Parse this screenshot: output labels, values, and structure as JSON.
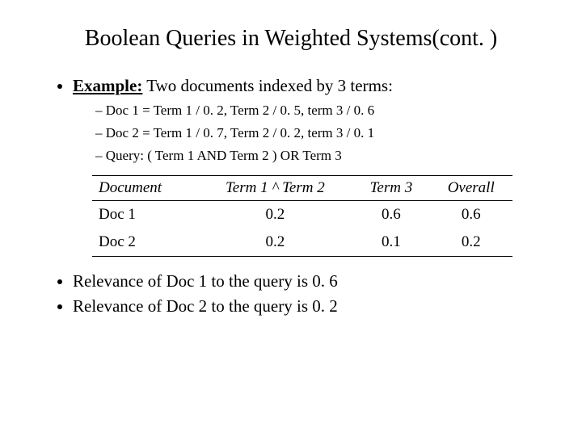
{
  "title": "Boolean Queries in Weighted Systems(cont. )",
  "example_label": "Example:",
  "example_text": " Two documents indexed by 3 terms:",
  "sub_items": [
    "Doc 1 = Term 1 / 0. 2, Term 2 / 0. 5, term 3 / 0. 6",
    "Doc 2 = Term 1 / 0. 7, Term 2 / 0. 2, term 3 / 0. 1",
    "Query: ( Term 1 AND Term 2 ) OR Term 3"
  ],
  "table": {
    "headers": [
      "Document",
      "Term 1 ^ Term 2",
      "Term 3",
      "Overall"
    ],
    "rows": [
      [
        "Doc 1",
        "0.2",
        "0.6",
        "0.6"
      ],
      [
        "Doc 2",
        "0.2",
        "0.1",
        "0.2"
      ]
    ]
  },
  "conclusions": [
    "Relevance of Doc 1 to the query is 0. 6",
    "Relevance of Doc 2 to the query is 0. 2"
  ],
  "chart_data": {
    "type": "table",
    "title": "Boolean query evaluation on weighted documents",
    "columns": [
      "Document",
      "Term 1 ^ Term 2",
      "Term 3",
      "Overall"
    ],
    "rows": [
      {
        "Document": "Doc 1",
        "Term 1 ^ Term 2": 0.2,
        "Term 3": 0.6,
        "Overall": 0.6
      },
      {
        "Document": "Doc 2",
        "Term 1 ^ Term 2": 0.2,
        "Term 3": 0.1,
        "Overall": 0.2
      }
    ]
  }
}
